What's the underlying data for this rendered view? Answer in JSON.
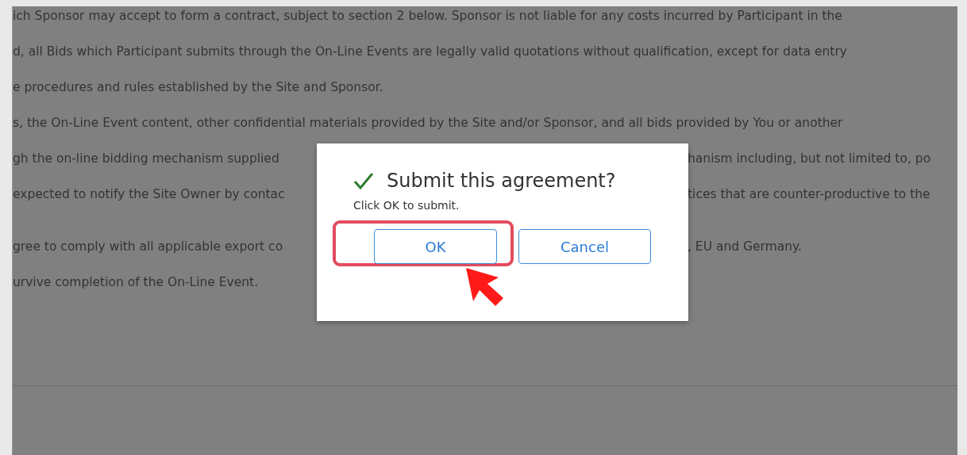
{
  "document": {
    "paragraphs": [
      {
        "lines": [
          {
            "left": "ich Sponsor may accept to form a contract, subject to section 2 below. Sponsor is not liable for any costs incurred by Participant in the"
          },
          {
            "left": "d, all Bids which Participant submits through the On-Line Events are legally valid quotations without qualification, except for data entry"
          },
          {
            "left": "e procedures and rules established by the Site and Sponsor."
          },
          {
            "left": "s, the On-Line Event content, other confidential materials provided by the Site and/or Sponsor, and all bids provided by You or another"
          },
          {
            "left": "gh the on-line bidding mechanism supplied",
            "right": "hanism including, but not limited to, po"
          },
          {
            "left": "expected to notify the Site Owner by contac",
            "right": "tices that are counter-productive to the"
          }
        ]
      },
      {
        "lines": [
          {
            "left": "gree to comply with all applicable export co",
            "right": ", EU and Germany."
          },
          {
            "left": "urvive completion of the On-Line Event."
          }
        ]
      }
    ]
  },
  "dialog": {
    "title": "Submit this agreement?",
    "message": "Click OK to submit.",
    "buttons": [
      {
        "label": "OK",
        "highlighted": true
      },
      {
        "label": "Cancel",
        "highlighted": false
      }
    ]
  }
}
